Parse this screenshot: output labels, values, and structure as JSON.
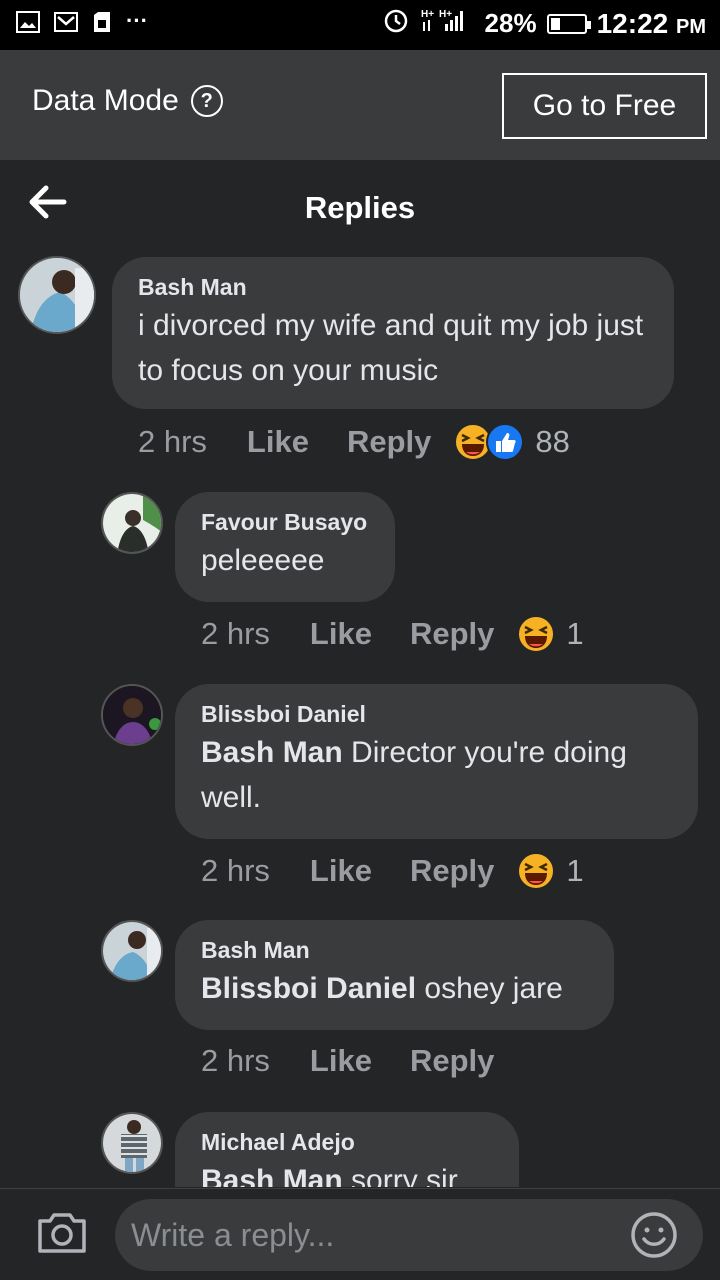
{
  "status_bar": {
    "battery": "28%",
    "battery_level": 0.28,
    "time": "12:22",
    "ampm": "PM",
    "network": "H+ H+"
  },
  "data_mode": {
    "label": "Data Mode",
    "help_symbol": "?",
    "go_free": "Go to Free"
  },
  "header": {
    "title": "Replies"
  },
  "comments": [
    {
      "author": "Bash Man",
      "mention": "",
      "text": "i divorced my wife and quit my job just to focus on your music",
      "time": "2 hrs",
      "like": "Like",
      "reply": "Reply",
      "reactions": [
        "haha-icon",
        "like-icon"
      ],
      "count": "88"
    },
    {
      "author": "Favour Busayo",
      "mention": "",
      "text": "peleeeee",
      "time": "2 hrs",
      "like": "Like",
      "reply": "Reply",
      "reactions": [
        "haha-icon"
      ],
      "count": "1"
    },
    {
      "author": "Blissboi Daniel",
      "mention": "Bash Man",
      "text": " Director you're doing well.",
      "time": "2 hrs",
      "like": "Like",
      "reply": "Reply",
      "reactions": [
        "haha-icon"
      ],
      "count": "1"
    },
    {
      "author": "Bash Man",
      "mention": "Blissboi Daniel",
      "text": " oshey jare",
      "time": "2 hrs",
      "like": "Like",
      "reply": "Reply",
      "reactions": [],
      "count": ""
    },
    {
      "author": "Michael Adejo",
      "mention": "Bash Man",
      "text": " sorry sir",
      "time": "",
      "like": "",
      "reply": "",
      "reactions": [],
      "count": ""
    }
  ],
  "composer": {
    "placeholder": "Write a reply..."
  },
  "colors": {
    "background": "#242527",
    "bubble": "#3a3b3c",
    "muted_text": "#9a9ca1",
    "haha": "#f7b125",
    "like_blue": "#1877f2"
  }
}
